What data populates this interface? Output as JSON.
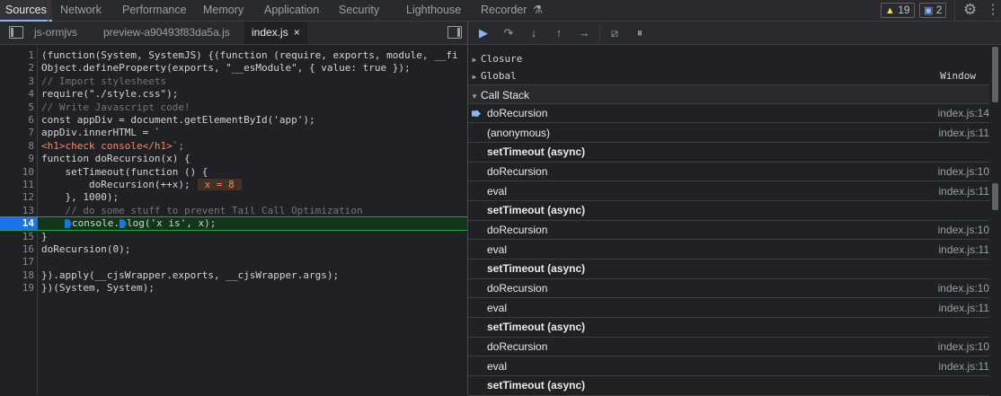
{
  "panel_tabs": [
    "Sources",
    "Network",
    "Performance",
    "Memory",
    "Application",
    "Security",
    "Lighthouse",
    "Recorder"
  ],
  "recorder_icon": "flask-icon",
  "badges": {
    "warnings": "19",
    "messages": "2"
  },
  "file_tabs": [
    "js-ormjvs",
    "preview-a90493f83da5a.js",
    "index.js"
  ],
  "close_glyph": "×",
  "inline_value": "x = 8",
  "current_line": "14",
  "code_lines": [
    {
      "n": "1"
    },
    {
      "n": "2"
    },
    {
      "n": "3"
    },
    {
      "n": "4"
    },
    {
      "n": "5"
    },
    {
      "n": "6"
    },
    {
      "n": "7"
    },
    {
      "n": "8"
    },
    {
      "n": "9"
    },
    {
      "n": "10"
    },
    {
      "n": "11"
    },
    {
      "n": "12"
    },
    {
      "n": "13"
    },
    {
      "n": "14"
    },
    {
      "n": "15"
    },
    {
      "n": "16"
    },
    {
      "n": "17"
    },
    {
      "n": "18"
    },
    {
      "n": "19"
    }
  ],
  "code_text": {
    "l1a": "(function(System, SystemJS) {(function (require, exports, module, __fi",
    "l2": "Object.defineProperty(exports, \"__esModule\", { value: true });",
    "l3": "// Import stylesheets",
    "l4": "require(\"./style.css\");",
    "l5": "// Write Javascript code!",
    "l6": "const appDiv = document.getElementById('app');",
    "l7": "appDiv.innerHTML = `",
    "l8": "<h1>check console</h1>`;",
    "l9": "function doRecursion(x) {",
    "l10": "    setTimeout(function () {",
    "l11": "        doRecursion(++x);",
    "l12": "    }, 1000);",
    "l13": "    // do some stuff to prevent Tail Call Optimization",
    "l14a": "console.",
    "l14b": "log('x is', x);",
    "l15": "}",
    "l16": "doRecursion(0);",
    "l17": "",
    "l18": "}).apply(__cjsWrapper.exports, __cjsWrapper.args);",
    "l19": "})(System, System);"
  },
  "scope": {
    "closure": "Closure",
    "global": "Global",
    "global_value": "Window"
  },
  "call_stack_title": "Call Stack",
  "frames": [
    {
      "name": "doRecursion",
      "loc": "index.js:14",
      "current": true
    },
    {
      "name": "(anonymous)",
      "loc": "index.js:11"
    },
    {
      "name": "setTimeout (async)",
      "loc": "",
      "async": true
    },
    {
      "name": "doRecursion",
      "loc": "index.js:10"
    },
    {
      "name": "eval",
      "loc": "index.js:11"
    },
    {
      "name": "setTimeout (async)",
      "loc": "",
      "async": true
    },
    {
      "name": "doRecursion",
      "loc": "index.js:10"
    },
    {
      "name": "eval",
      "loc": "index.js:11"
    },
    {
      "name": "setTimeout (async)",
      "loc": "",
      "async": true
    },
    {
      "name": "doRecursion",
      "loc": "index.js:10"
    },
    {
      "name": "eval",
      "loc": "index.js:11"
    },
    {
      "name": "setTimeout (async)",
      "loc": "",
      "async": true
    },
    {
      "name": "doRecursion",
      "loc": "index.js:10"
    },
    {
      "name": "eval",
      "loc": "index.js:11"
    },
    {
      "name": "setTimeout (async)",
      "loc": "",
      "async": true
    }
  ]
}
